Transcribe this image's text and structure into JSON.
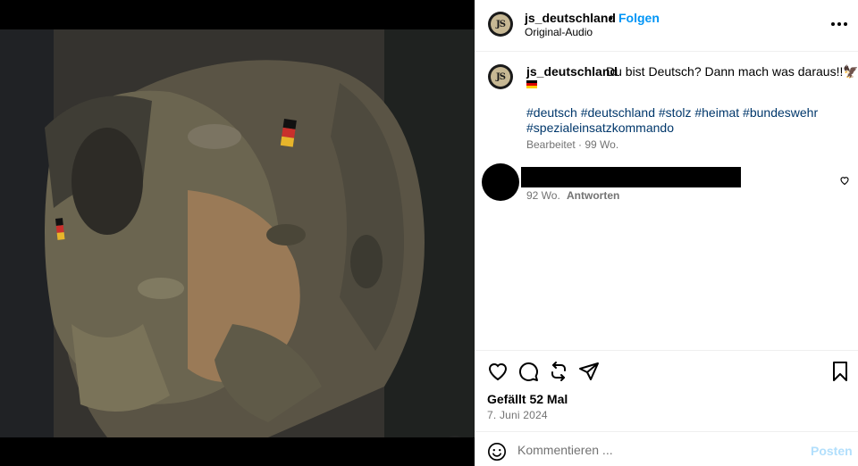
{
  "post": {
    "username": "js_deutschland",
    "separator": "•",
    "follow_label": "Folgen",
    "audio_label": "Original-Audio",
    "avatar_initials": "JS"
  },
  "caption": {
    "username": "js_deutschland",
    "text": "Du bist Deutsch? Dann mach was daraus!!🦅",
    "hashtags": "#deutsch #deutschland #stolz #heimat #bundeswehr #spezialeinsatzkommando",
    "edited_label": "Bearbeitet · 99 Wo."
  },
  "comment": {
    "time": "92 Wo.",
    "reply_label": "Antworten"
  },
  "stats": {
    "likes": "Gefällt 52 Mal",
    "date": "7. Juni 2024"
  },
  "composer": {
    "placeholder": "Kommentieren ...",
    "post_label": "Posten"
  },
  "icons": {
    "more": "more-options-icon",
    "like": "heart-icon",
    "comment": "comment-icon",
    "repost": "repost-icon",
    "share": "share-icon",
    "save": "bookmark-icon",
    "emoji": "emoji-icon",
    "mute": "muted-speaker-icon"
  },
  "colors": {
    "link": "#0095f6",
    "hashtag": "#00376b",
    "muted_text": "#737373",
    "post_disabled": "#b2dffc"
  }
}
